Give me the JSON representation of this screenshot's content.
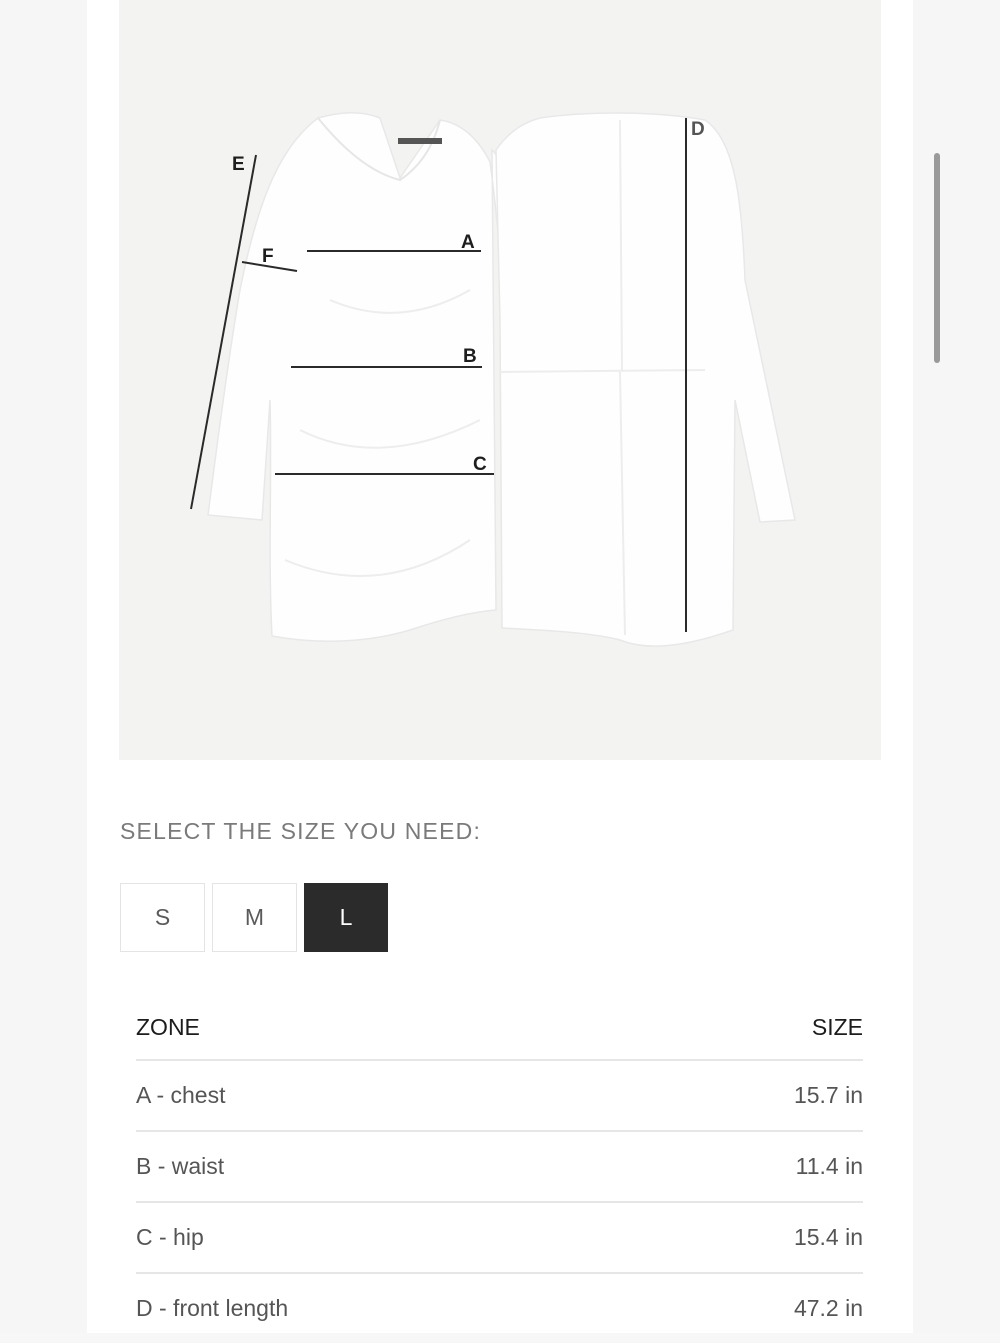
{
  "diagram": {
    "labels": [
      "A",
      "B",
      "C",
      "D",
      "E",
      "F"
    ]
  },
  "size_selector": {
    "heading": "SELECT THE SIZE YOU NEED:",
    "options": [
      "S",
      "M",
      "L"
    ],
    "selected": "L"
  },
  "size_table": {
    "headers": {
      "zone": "ZONE",
      "size": "SIZE"
    },
    "rows": [
      {
        "zone": "A - chest",
        "size": "15.7 in"
      },
      {
        "zone": "B - waist",
        "size": "11.4 in"
      },
      {
        "zone": "C - hip",
        "size": "15.4 in"
      },
      {
        "zone": "D - front length",
        "size": "47.2 in"
      }
    ]
  },
  "colors": {
    "selected_bg": "#2b2b2b",
    "divider": "#e6e6e6",
    "heading_text": "#7a7a7a"
  }
}
